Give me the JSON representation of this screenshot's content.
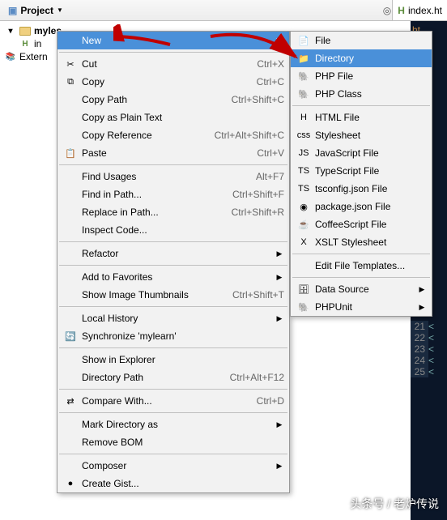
{
  "toolbar": {
    "project_label": "Project"
  },
  "editor_tab": {
    "label": "index.ht"
  },
  "tree": {
    "root": "myles",
    "child1": "in",
    "child2": "Extern"
  },
  "editor_snippet": "ht",
  "line_numbers": [
    "21",
    "22",
    "23",
    "24",
    "25"
  ],
  "menu1": [
    {
      "type": "item",
      "label": "New",
      "shortcut": "",
      "arrow": true,
      "hover": true,
      "icon": ""
    },
    {
      "type": "sep"
    },
    {
      "type": "item",
      "label": "Cut",
      "shortcut": "Ctrl+X",
      "icon": "✂"
    },
    {
      "type": "item",
      "label": "Copy",
      "shortcut": "Ctrl+C",
      "icon": "⧉"
    },
    {
      "type": "item",
      "label": "Copy Path",
      "shortcut": "Ctrl+Shift+C"
    },
    {
      "type": "item",
      "label": "Copy as Plain Text",
      "shortcut": ""
    },
    {
      "type": "item",
      "label": "Copy Reference",
      "shortcut": "Ctrl+Alt+Shift+C"
    },
    {
      "type": "item",
      "label": "Paste",
      "shortcut": "Ctrl+V",
      "icon": "📋"
    },
    {
      "type": "sep"
    },
    {
      "type": "item",
      "label": "Find Usages",
      "shortcut": "Alt+F7"
    },
    {
      "type": "item",
      "label": "Find in Path...",
      "shortcut": "Ctrl+Shift+F"
    },
    {
      "type": "item",
      "label": "Replace in Path...",
      "shortcut": "Ctrl+Shift+R"
    },
    {
      "type": "item",
      "label": "Inspect Code...",
      "shortcut": ""
    },
    {
      "type": "sep"
    },
    {
      "type": "item",
      "label": "Refactor",
      "shortcut": "",
      "arrow": true
    },
    {
      "type": "sep"
    },
    {
      "type": "item",
      "label": "Add to Favorites",
      "shortcut": "",
      "arrow": true
    },
    {
      "type": "item",
      "label": "Show Image Thumbnails",
      "shortcut": "Ctrl+Shift+T"
    },
    {
      "type": "sep"
    },
    {
      "type": "item",
      "label": "Local History",
      "shortcut": "",
      "arrow": true
    },
    {
      "type": "item",
      "label": "Synchronize 'mylearn'",
      "shortcut": "",
      "icon": "🔄"
    },
    {
      "type": "sep"
    },
    {
      "type": "item",
      "label": "Show in Explorer",
      "shortcut": ""
    },
    {
      "type": "item",
      "label": "Directory Path",
      "shortcut": "Ctrl+Alt+F12"
    },
    {
      "type": "sep"
    },
    {
      "type": "item",
      "label": "Compare With...",
      "shortcut": "Ctrl+D",
      "icon": "⇄"
    },
    {
      "type": "sep"
    },
    {
      "type": "item",
      "label": "Mark Directory as",
      "shortcut": "",
      "arrow": true
    },
    {
      "type": "item",
      "label": "Remove BOM",
      "shortcut": ""
    },
    {
      "type": "sep"
    },
    {
      "type": "item",
      "label": "Composer",
      "shortcut": "",
      "arrow": true
    },
    {
      "type": "item",
      "label": "Create Gist...",
      "shortcut": "",
      "icon": "●"
    }
  ],
  "menu2": [
    {
      "type": "item",
      "label": "File",
      "icon": "file"
    },
    {
      "type": "item",
      "label": "Directory",
      "icon": "folder",
      "hover": true
    },
    {
      "type": "item",
      "label": "PHP File",
      "icon": "php"
    },
    {
      "type": "item",
      "label": "PHP Class",
      "icon": "php"
    },
    {
      "type": "sep"
    },
    {
      "type": "item",
      "label": "HTML File",
      "icon": "html"
    },
    {
      "type": "item",
      "label": "Stylesheet",
      "icon": "css"
    },
    {
      "type": "item",
      "label": "JavaScript File",
      "icon": "js"
    },
    {
      "type": "item",
      "label": "TypeScript File",
      "icon": "ts"
    },
    {
      "type": "item",
      "label": "tsconfig.json File",
      "icon": "ts"
    },
    {
      "type": "item",
      "label": "package.json File",
      "icon": "pkg"
    },
    {
      "type": "item",
      "label": "CoffeeScript File",
      "icon": "cs"
    },
    {
      "type": "item",
      "label": "XSLT Stylesheet",
      "icon": "xsl"
    },
    {
      "type": "sep"
    },
    {
      "type": "item",
      "label": "Edit File Templates..."
    },
    {
      "type": "sep"
    },
    {
      "type": "item",
      "label": "Data Source",
      "icon": "db",
      "arrow": true
    },
    {
      "type": "item",
      "label": "PHPUnit",
      "icon": "php",
      "arrow": true
    }
  ],
  "icon_map": {
    "file": "📄",
    "folder": "📁",
    "php": "🐘",
    "html": "H",
    "css": "css",
    "js": "JS",
    "ts": "TS",
    "pkg": "◉",
    "cs": "☕",
    "xsl": "X",
    "db": "🗄"
  },
  "watermark": "头条号 / 老炉传说"
}
